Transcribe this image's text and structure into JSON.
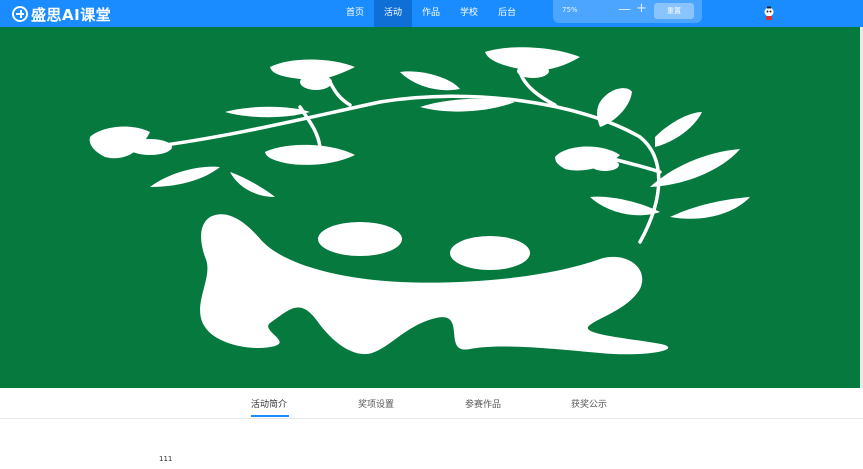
{
  "header": {
    "logo_text": "盛思AI课堂",
    "brand_color": "#1a8cff",
    "nav": [
      {
        "label": "首页",
        "active": false
      },
      {
        "label": "活动",
        "active": true
      },
      {
        "label": "作品",
        "active": false
      },
      {
        "label": "学校",
        "active": false
      },
      {
        "label": "后台",
        "active": false
      }
    ],
    "zoom": {
      "value": "75%",
      "minus": "—",
      "plus": "+",
      "reset_label": "重置"
    },
    "avatar_icon": "avatar-icon"
  },
  "banner": {
    "background_color": "#05793e",
    "emblem_icon": "leaf-wreath-people-emblem"
  },
  "tabs": [
    {
      "label": "活动简介",
      "active": true
    },
    {
      "label": "奖项设置",
      "active": false
    },
    {
      "label": "参赛作品",
      "active": false
    },
    {
      "label": "获奖公示",
      "active": false
    }
  ],
  "content": {
    "text": "111"
  }
}
